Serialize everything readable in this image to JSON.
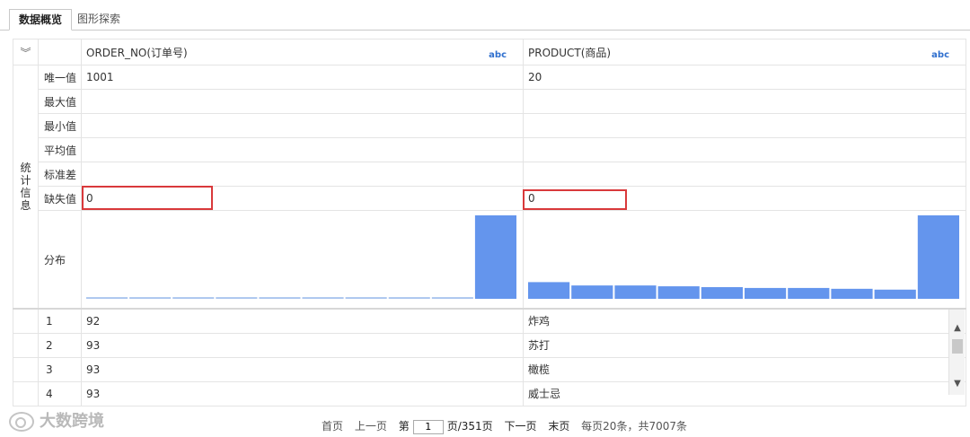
{
  "tabs": {
    "active": "数据概览",
    "inactive": "图形探索"
  },
  "columns": [
    {
      "name": "ORDER_NO(订单号)",
      "type_badge": "abc"
    },
    {
      "name": "PRODUCT(商品)",
      "type_badge": "abc"
    }
  ],
  "stats_section_label": "统计信息",
  "stats": {
    "unique": {
      "label": "唯一值",
      "col1": "1001",
      "col2": "20"
    },
    "max": {
      "label": "最大值",
      "col1": "",
      "col2": ""
    },
    "min": {
      "label": "最小值",
      "col1": "",
      "col2": ""
    },
    "mean": {
      "label": "平均值",
      "col1": "",
      "col2": ""
    },
    "std": {
      "label": "标准差",
      "col1": "",
      "col2": ""
    },
    "missing": {
      "label": "缺失值",
      "col1": "0",
      "col2": "0"
    },
    "distribution": {
      "label": "分布"
    }
  },
  "chart_data": [
    {
      "type": "bar",
      "values": [
        1,
        1,
        1,
        1,
        1,
        1,
        1,
        1,
        1,
        50
      ],
      "ylim": [
        0,
        50
      ],
      "bar_color": "#6495ed"
    },
    {
      "type": "bar",
      "values": [
        10,
        8,
        8,
        7.5,
        7,
        6.5,
        6.5,
        6,
        5.5,
        50
      ],
      "ylim": [
        0,
        50
      ],
      "bar_color": "#6495ed"
    }
  ],
  "rows": [
    {
      "index": "1",
      "col1": "92",
      "col2": "炸鸡"
    },
    {
      "index": "2",
      "col1": "93",
      "col2": "苏打"
    },
    {
      "index": "3",
      "col1": "93",
      "col2": "橄榄"
    },
    {
      "index": "4",
      "col1": "93",
      "col2": "威士忌"
    }
  ],
  "pager": {
    "first": "首页",
    "prev": "上一页",
    "page_prefix": "第",
    "current_page": "1",
    "total_pages": "页/351页",
    "next": "下一页",
    "last": "末页",
    "summary": "每页20条，共7007条"
  },
  "watermark": "大数跨境",
  "colors": {
    "highlight": "#d9393b",
    "bar": "#6495ed",
    "badge": "#2f6fce"
  }
}
